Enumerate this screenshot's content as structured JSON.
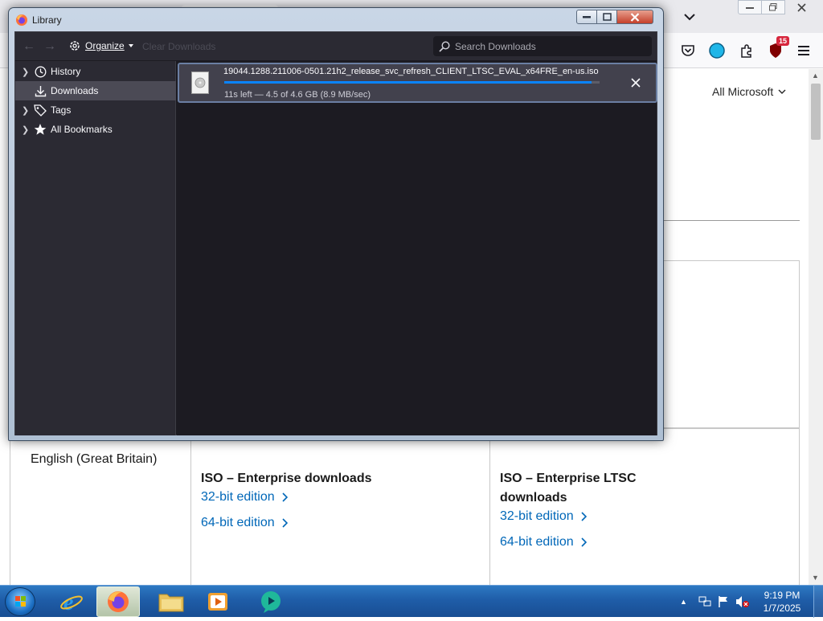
{
  "browser": {
    "page": {
      "locale_menu": "All Microsoft",
      "language": "English (Great Britain)",
      "sections": [
        {
          "heading": "ISO – Enterprise downloads",
          "heading_lines": [
            "ISO – Enterprise downloads"
          ],
          "links": [
            "32-bit edition",
            "64-bit edition"
          ]
        },
        {
          "heading": "ISO – Enterprise LTSC downloads",
          "heading_lines": [
            "ISO – Enterprise LTSC",
            "downloads"
          ],
          "links": [
            "32-bit edition",
            "64-bit edition"
          ]
        }
      ]
    },
    "toolbar": {
      "extension_badge": "15"
    }
  },
  "library": {
    "title": "Library",
    "toolbar": {
      "organize_label": "Organize",
      "clear_label": "Clear Downloads",
      "search_placeholder": "Search Downloads"
    },
    "sidebar": {
      "items": [
        {
          "label": "History",
          "icon": "clock-icon",
          "expandable": true,
          "selected": false
        },
        {
          "label": "Downloads",
          "icon": "download-icon",
          "expandable": false,
          "selected": true
        },
        {
          "label": "Tags",
          "icon": "tag-icon",
          "expandable": true,
          "selected": false
        },
        {
          "label": "All Bookmarks",
          "icon": "star-icon",
          "expandable": true,
          "selected": false
        }
      ]
    },
    "downloads": [
      {
        "filename": "19044.1288.211006-0501.21h2_release_svc_refresh_CLIENT_LTSC_EVAL_x64FRE_en-us.iso",
        "status": "11s left — 4.5 of 4.6 GB (8.9 MB/sec)",
        "progress_fraction": 0.978
      }
    ]
  },
  "taskbar": {
    "apps": [
      "internet-explorer",
      "firefox",
      "file-explorer",
      "media-player",
      "app-icon"
    ],
    "active_app": "firefox",
    "clock": {
      "time": "9:19 PM",
      "date": "1/7/2025"
    }
  },
  "colors": {
    "link": "#0067b8",
    "progress": "#0a84ff",
    "library_bg": "#1c1b22",
    "sidebar_bg": "#2b2a33",
    "selected_row": "#4b4a55"
  }
}
